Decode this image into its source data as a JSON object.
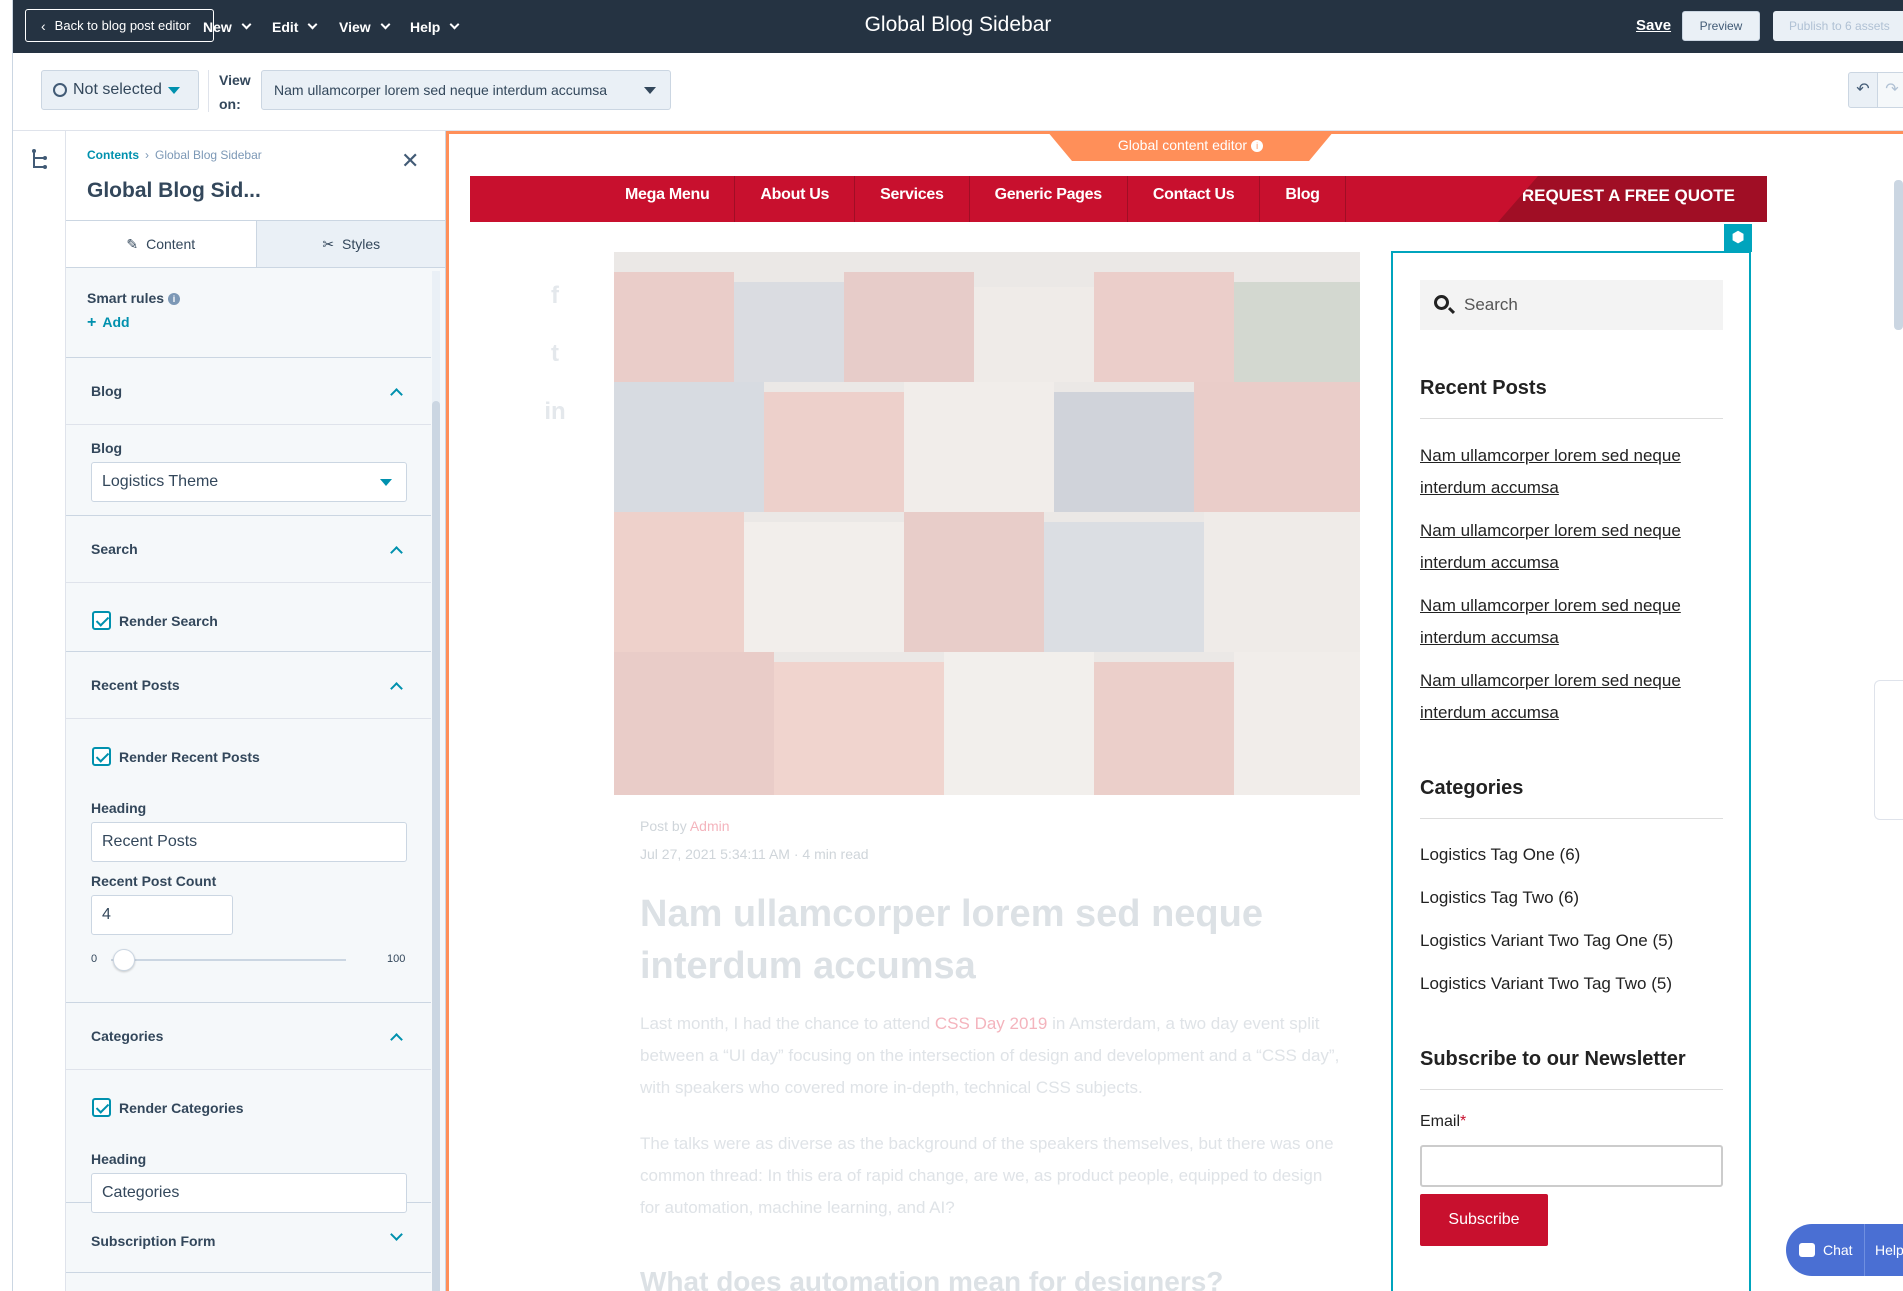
{
  "topbar": {
    "back_label": "Back to blog post editor",
    "menus": [
      "New",
      "Edit",
      "View",
      "Help"
    ],
    "title": "Global Blog Sidebar",
    "save_label": "Save",
    "preview_label": "Preview",
    "publish_label": "Publish to 6 assets"
  },
  "toolbar": {
    "language_select": "Not selected",
    "view_on_label": "View on:",
    "view_on_value": "Nam ullamcorper lorem sed neque interdum accumsa"
  },
  "panel": {
    "breadcrumb_root": "Contents",
    "breadcrumb_current": "Global Blog Sidebar",
    "title": "Global Blog Sid...",
    "tabs": {
      "content": "Content",
      "styles": "Styles"
    },
    "smart_rules_label": "Smart rules",
    "add_label": "Add",
    "sections": {
      "blog": {
        "title": "Blog",
        "field_label": "Blog",
        "value": "Logistics Theme"
      },
      "search": {
        "title": "Search",
        "checkbox_label": "Render Search"
      },
      "recent_posts": {
        "title": "Recent Posts",
        "checkbox_label": "Render Recent Posts",
        "heading_label": "Heading",
        "heading_value": "Recent Posts",
        "count_label": "Recent Post Count",
        "count_value": "4",
        "slider_min": "0",
        "slider_max": "100",
        "slider_value": 4
      },
      "categories": {
        "title": "Categories",
        "checkbox_label": "Render Categories",
        "heading_label": "Heading",
        "heading_value": "Categories"
      },
      "subscription": {
        "title": "Subscription Form"
      }
    }
  },
  "preview": {
    "editor_tab_label": "Global content editor",
    "nav_items": [
      "Mega Menu",
      "About Us",
      "Services",
      "Generic Pages",
      "Contact Us",
      "Blog"
    ],
    "quote_label": "REQUEST A FREE QUOTE",
    "post": {
      "meta_prefix": "Post by",
      "author": "Admin",
      "date": "Jul 27, 2021 5:34:11 AM · 4 min read",
      "title": "Nam ullamcorper lorem sed neque interdum accumsa",
      "para1_a": "Last month, I had the chance to attend",
      "para1_link": "CSS Day 2019",
      "para1_b": "in Amsterdam, a two day event split between a “UI day” focusing on the intersection of design and development and a “CSS day”, with speakers who covered more in-depth, technical CSS subjects.",
      "para2": "The talks were as diverse as the background of the speakers themselves, but there was one common thread: In this era of rapid change, are we, as product people, equipped to design for automation, machine learning, and AI?",
      "h2": "What does automation mean for designers?"
    },
    "sidebar": {
      "search_placeholder": "Search",
      "recent_heading": "Recent Posts",
      "recent_posts": [
        "Nam ullamcorper lorem sed neque interdum accumsa",
        "Nam ullamcorper lorem sed neque interdum accumsa",
        "Nam ullamcorper lorem sed neque interdum accumsa",
        "Nam ullamcorper lorem sed neque interdum accumsa"
      ],
      "categories_heading": "Categories",
      "categories": [
        "Logistics Tag One (6)",
        "Logistics Tag Two (6)",
        "Logistics Variant Two Tag One (5)",
        "Logistics Variant Two Tag Two (5)"
      ],
      "newsletter_heading": "Subscribe to our Newsletter",
      "email_label": "Email",
      "email_required": "*",
      "subscribe_label": "Subscribe"
    },
    "chat_label": "Chat",
    "help_label": "Help"
  },
  "colors": {
    "topbar": "#253342",
    "accent": "#0091ae",
    "editor_orange": "#ff8f59",
    "brand_red": "#c8102e",
    "module_outline": "#00a4bd"
  }
}
